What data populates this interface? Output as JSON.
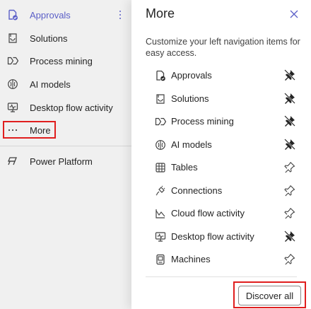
{
  "nav": {
    "items": [
      {
        "label": "Approvals",
        "icon": "approvals-icon",
        "active": true
      },
      {
        "label": "Solutions",
        "icon": "solutions-icon"
      },
      {
        "label": "Process mining",
        "icon": "process-mining-icon"
      },
      {
        "label": "AI models",
        "icon": "ai-models-icon"
      },
      {
        "label": "Desktop flow activity",
        "icon": "desktop-flow-activity-icon"
      },
      {
        "label": "More",
        "icon": "more-icon"
      }
    ],
    "platform": {
      "label": "Power Platform",
      "icon": "power-platform-icon"
    }
  },
  "flyout": {
    "title": "More",
    "description": "Customize your left navigation items for easy access.",
    "items": [
      {
        "label": "Approvals",
        "icon": "approvals-icon",
        "pinned": true
      },
      {
        "label": "Solutions",
        "icon": "solutions-icon",
        "pinned": true
      },
      {
        "label": "Process mining",
        "icon": "process-mining-icon",
        "pinned": true
      },
      {
        "label": "AI models",
        "icon": "ai-models-icon",
        "pinned": true
      },
      {
        "label": "Tables",
        "icon": "tables-icon",
        "pinned": false
      },
      {
        "label": "Connections",
        "icon": "connections-icon",
        "pinned": false
      },
      {
        "label": "Cloud flow activity",
        "icon": "cloud-flow-activity-icon",
        "pinned": false
      },
      {
        "label": "Desktop flow activity",
        "icon": "desktop-flow-activity-icon",
        "pinned": true
      },
      {
        "label": "Machines",
        "icon": "machines-icon",
        "pinned": false
      }
    ],
    "discover_label": "Discover all"
  },
  "colors": {
    "accent": "#5b5fc7",
    "highlight": "#e01e1e"
  }
}
